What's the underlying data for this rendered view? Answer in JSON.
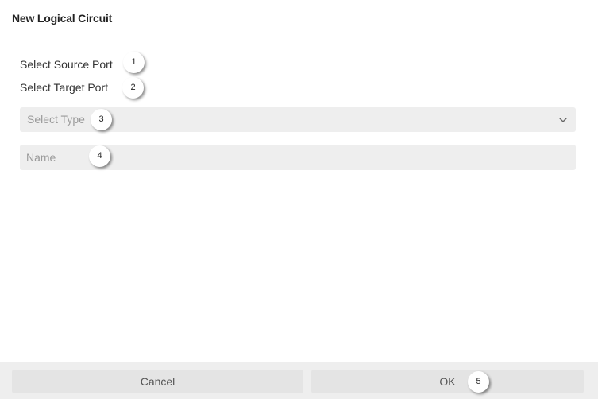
{
  "dialog": {
    "title": "New Logical Circuit"
  },
  "form": {
    "source_port_label": "Select Source Port",
    "target_port_label": "Select Target Port",
    "type_select": {
      "placeholder": "Select Type",
      "icon": "chevron-down-icon"
    },
    "name_field": {
      "placeholder": "Name",
      "value": ""
    }
  },
  "footer": {
    "cancel_label": "Cancel",
    "ok_label": "OK"
  },
  "annotations": [
    "1",
    "2",
    "3",
    "4",
    "5"
  ]
}
